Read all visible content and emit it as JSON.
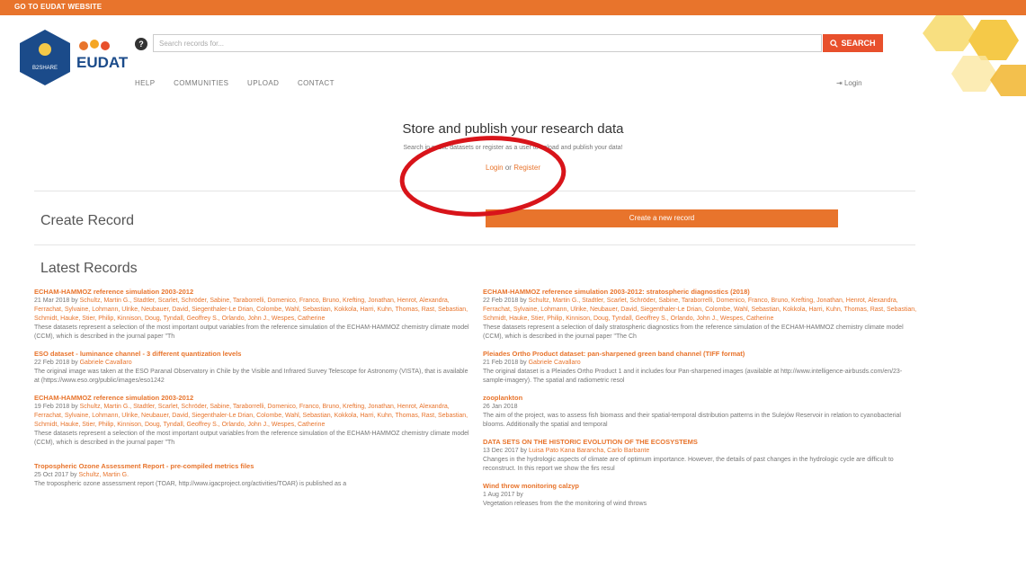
{
  "topbar": {
    "link": "GO TO EUDAT WEBSITE"
  },
  "logo": {
    "hex_text": "B2SHARE",
    "word": "EUDAT"
  },
  "search": {
    "placeholder": "Search records for...",
    "button": "SEARCH",
    "help_icon": "question-icon"
  },
  "nav": {
    "items": [
      "HELP",
      "COMMUNITIES",
      "UPLOAD",
      "CONTACT"
    ],
    "login": "Login"
  },
  "hero": {
    "title": "Store and publish your research data",
    "subtitle": "Search in public datasets or register as a user to upload and publish your data!",
    "login": "Login",
    "or": "or",
    "register": "Register"
  },
  "create": {
    "title": "Create Record",
    "button": "Create a new record"
  },
  "latest": {
    "title": "Latest Records",
    "left": [
      {
        "title": "ECHAM-HAMMOZ reference simulation 2003-2012",
        "date": "21 Mar 2018 by",
        "authors": "Schultz, Martin G., Stadtler, Scarlet, Schröder, Sabine, Taraborrelli, Domenico, Franco, Bruno, Krefting, Jonathan, Henrot, Alexandra, Ferrachat, Sylvaine, Lohmann, Ulrike, Neubauer, David, Siegenthaler-Le Drian, Colombe, Wahl, Sebastian, Kokkola, Harri, Kuhn, Thomas, Rast, Sebastian, Schmidt, Hauke, Stier, Philip, Kinnison, Doug, Tyndall, Geoffrey S., Orlando, John J., Wespes, Catherine",
        "desc": "These datasets represent a selection of the most important output variables from the reference simulation of the ECHAM-HAMMOZ chemistry climate model (CCM), which is described in the journal paper \"Th"
      },
      {
        "title": "ESO dataset - luminance channel - 3 different quantization levels",
        "date": "22 Feb 2018 by",
        "authors": "Gabriele Cavallaro",
        "desc": "The original image was taken at the ESO Paranal Observatory in Chile by the Visible and Infrared Survey Telescope for Astronomy (VISTA), that is available at (https://www.eso.org/public/images/eso1242"
      },
      {
        "title": "ECHAM-HAMMOZ reference simulation 2003-2012",
        "date": "19 Feb 2018 by",
        "authors": "Schultz, Martin G., Stadtler, Scarlet, Schröder, Sabine, Taraborrelli, Domenico, Franco, Bruno, Krefting, Jonathan, Henrot, Alexandra, Ferrachat, Sylvaine, Lohmann, Ulrike, Neubauer, David, Siegenthaler-Le Drian, Colombe, Wahl, Sebastian, Kokkola, Harri, Kuhn, Thomas, Rast, Sebastian, Schmidt, Hauke, Stier, Philip, Kinnison, Doug, Tyndall, Geoffrey S., Orlando, John J., Wespes, Catherine",
        "desc": "These datasets represent a selection of the most important output variables from the reference simulation of the ECHAM-HAMMOZ chemistry climate model (CCM), which is described in the journal paper \"Th"
      },
      {
        "title": "Tropospheric Ozone Assessment Report - pre-compiled metrics files",
        "date": "25 Oct 2017 by",
        "authors": "Schultz, Martin G.",
        "desc": "The tropospheric ozone assessment report (TOAR, http://www.igacproject.org/activities/TOAR) is published as a"
      }
    ],
    "right": [
      {
        "title": "ECHAM-HAMMOZ reference simulation 2003-2012: stratospheric diagnostics (2018)",
        "date": "22 Feb 2018 by",
        "authors": "Schultz, Martin G., Stadtler, Scarlet, Schröder, Sabine, Taraborrelli, Domenico, Franco, Bruno, Krefting, Jonathan, Henrot, Alexandra, Ferrachat, Sylvaine, Lohmann, Ulrike, Neubauer, David, Siegenthaler-Le Drian, Colombe, Wahl, Sebastian, Kokkola, Harri, Kuhn, Thomas, Rast, Sebastian, Schmidt, Hauke, Stier, Philip, Kinnison, Doug, Tyndall, Geoffrey S., Orlando, John J., Wespes, Catherine",
        "desc": "These datasets represent a selection of daily stratospheric diagnostics from the reference simulation of the ECHAM-HAMMOZ chemistry climate model (CCM), which is described in the journal paper \"The Ch"
      },
      {
        "title": "Pleiades Ortho Product dataset: pan-sharpened green band channel (TIFF format)",
        "date": "21 Feb 2018 by",
        "authors": "Gabriele Cavallaro",
        "desc": "The original dataset is a Pleiades Ortho Product 1 and it includes four Pan-sharpened images (available at http://www.intelligence-airbusds.com/en/23-sample-imagery). The spatial and radiometric resol"
      },
      {
        "title": "zooplankton",
        "date": "26 Jan 2018",
        "authors": "",
        "desc": "The aim of the project, was to assess fish biomass and their spatial-temporal distribution patterns in the Sulejów Reservoir in relation to cyanobacterial blooms. Additionally the spatial and temporal"
      },
      {
        "title": "DATA SETS ON THE HISTORIC EVOLUTION OF THE ECOSYSTEMS",
        "date": "13 Dec 2017 by",
        "authors": "Luisa Pato Kana Barancha, Carlo Barbante",
        "desc": "Changes in the hydrologic aspects of climate are of optimum importance. However, the details of past changes in the hydrologic cycle are difficult to reconstruct. In this report we show the firs resul"
      },
      {
        "title": "Wind throw monitoring calzyp",
        "date": "1 Aug 2017 by",
        "authors": "",
        "desc": "Vegetation releases from the the monitoring of wind throws"
      }
    ]
  },
  "colors": {
    "accent": "#e8742c",
    "search_button": "#e8502c",
    "annotation_ring": "#d8141a",
    "logo_blue": "#1b4b8a"
  }
}
